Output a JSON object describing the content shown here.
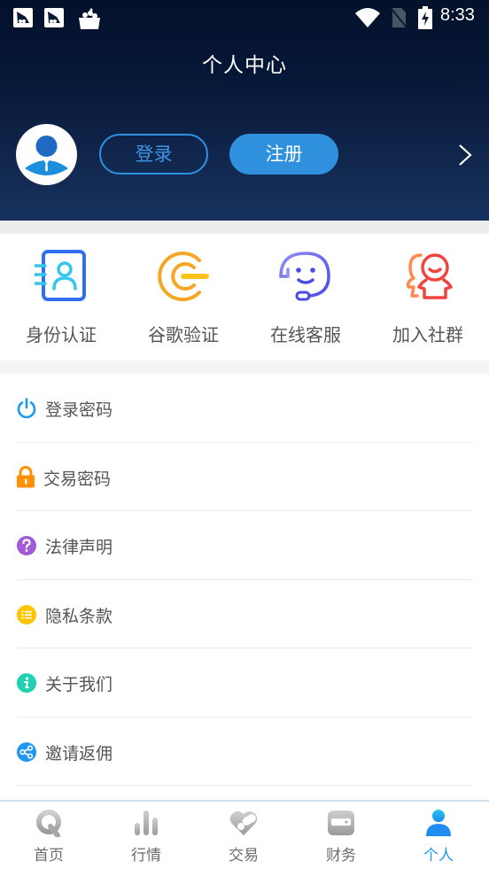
{
  "status_bar": {
    "time": "8:33",
    "icons": [
      "notification-app-icon",
      "notification-app-icon",
      "notification-basket-icon",
      "wifi-icon",
      "no-sim-icon",
      "battery-charging-icon"
    ]
  },
  "header": {
    "title": "个人中心",
    "login_label": "登录",
    "register_label": "注册",
    "accent_color": "#2f90dd",
    "background_color": "#061737"
  },
  "quick_actions": [
    {
      "label": "身份认证",
      "icon": "id-card-icon",
      "color": "#2f6ff0"
    },
    {
      "label": "谷歌验证",
      "icon": "google-auth-icon",
      "color": "#f5a623"
    },
    {
      "label": "在线客服",
      "icon": "customer-service-icon",
      "color": "#5b5ef0"
    },
    {
      "label": "加入社群",
      "icon": "community-icon",
      "color": "#f05a3c"
    }
  ],
  "menu": [
    {
      "label": "登录密码",
      "icon": "power-icon",
      "color": "#1a9bf0"
    },
    {
      "label": "交易密码",
      "icon": "lock-icon",
      "color": "#ff9100"
    },
    {
      "label": "法律声明",
      "icon": "question-icon",
      "color": "#a25ad9"
    },
    {
      "label": "隐私条款",
      "icon": "list-icon",
      "color": "#ffc400"
    },
    {
      "label": "关于我们",
      "icon": "info-icon",
      "color": "#1fd1b0"
    },
    {
      "label": "邀请返佣",
      "icon": "share-icon",
      "color": "#2196f3"
    }
  ],
  "tabbar": {
    "active_index": 4,
    "active_color": "#1f9af0",
    "items": [
      {
        "label": "首页",
        "icon": "home-q-icon"
      },
      {
        "label": "行情",
        "icon": "chart-bars-icon"
      },
      {
        "label": "交易",
        "icon": "trade-pill-icon"
      },
      {
        "label": "财务",
        "icon": "wallet-icon"
      },
      {
        "label": "个人",
        "icon": "person-icon"
      }
    ]
  }
}
